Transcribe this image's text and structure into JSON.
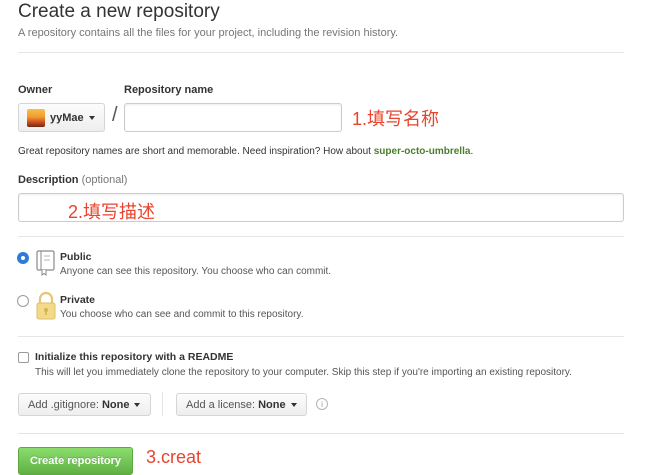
{
  "header": {
    "title": "Create a new repository",
    "subtitle": "A repository contains all the files for your project, including the revision history."
  },
  "owner": {
    "label": "Owner",
    "value": "yyMae"
  },
  "repo_name": {
    "label": "Repository name",
    "value": "",
    "slash": "/",
    "annotation": "1.填写名称"
  },
  "hint": {
    "text": "Great repository names are short and memorable. Need inspiration? How about ",
    "suggestion": "super-octo-umbrella",
    "end": "."
  },
  "description": {
    "label": "Description",
    "optional": "(optional)",
    "value": "",
    "annotation": "2.填写描述"
  },
  "visibility": {
    "selected": "public",
    "public": {
      "title": "Public",
      "desc": "Anyone can see this repository. You choose who can commit."
    },
    "private": {
      "title": "Private",
      "desc": "You choose who can see and commit to this repository."
    }
  },
  "readme": {
    "checked": false,
    "title": "Initialize this repository with a README",
    "desc": "This will let you immediately clone the repository to your computer. Skip this step if you're importing an existing repository."
  },
  "gitignore": {
    "prefix": "Add .gitignore:",
    "value": "None"
  },
  "license": {
    "prefix": "Add a license:",
    "value": "None"
  },
  "submit": {
    "label": "Create repository",
    "annotation": "3.creat",
    "color": "#60b044"
  },
  "colors": {
    "accent_blue": "#2f7bd9",
    "annotation_red": "#e8442e",
    "suggestion_green": "#4a7d2c"
  }
}
